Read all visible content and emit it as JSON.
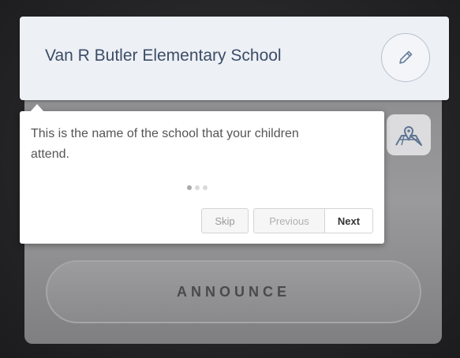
{
  "school": {
    "name": "Van R Butler Elementary School",
    "edit_icon": "pencil-icon"
  },
  "map_button": {
    "icon": "map-pin-icon"
  },
  "announce": {
    "label": "ANNOUNCE"
  },
  "tour": {
    "text": "This is the name of the school that your children attend.",
    "step": 1,
    "steps": 3,
    "skip_label": "Skip",
    "previous_label": "Previous",
    "next_label": "Next"
  },
  "colors": {
    "school_text": "#3c4d66",
    "card_bg": "#edf0f5",
    "map_icon": "#5e7592"
  }
}
